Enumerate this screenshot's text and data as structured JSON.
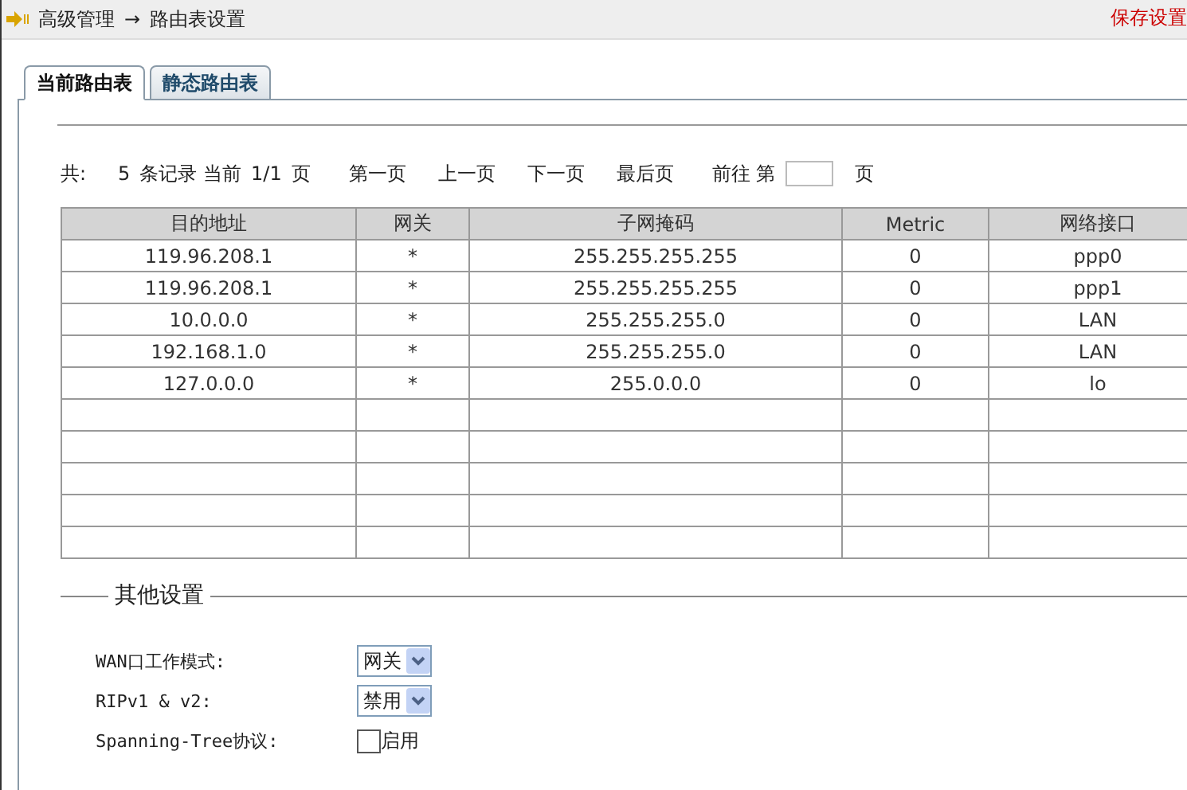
{
  "breadcrumb": {
    "parent": "高级管理",
    "separator": "→",
    "current": "路由表设置"
  },
  "save_link": "保存设置",
  "tabs": [
    {
      "label": "当前路由表",
      "selected": true
    },
    {
      "label": "静态路由表",
      "selected": false
    }
  ],
  "pagination": {
    "summary_prefix": "共:",
    "count": "5",
    "summary_mid": "条记录 当前",
    "page": "1/1",
    "page_unit": "页",
    "first": "第一页",
    "prev": "上一页",
    "next": "下一页",
    "last": "最后页",
    "goto_prefix": "前往 第",
    "goto_suffix": "页"
  },
  "table": {
    "columns": [
      "目的地址",
      "网关",
      "子网掩码",
      "Metric",
      "网络接口"
    ],
    "rows": [
      {
        "kind": "data",
        "cells": [
          "119.96.208.1",
          "*",
          "255.255.255.255",
          "0",
          "ppp0"
        ]
      },
      {
        "kind": "data",
        "cells": [
          "119.96.208.1",
          "*",
          "255.255.255.255",
          "0",
          "ppp1"
        ]
      },
      {
        "kind": "data",
        "cells": [
          "10.0.0.0",
          "*",
          "255.255.255.0",
          "0",
          "LAN"
        ]
      },
      {
        "kind": "data",
        "cells": [
          "192.168.1.0",
          "*",
          "255.255.255.0",
          "0",
          "LAN"
        ]
      },
      {
        "kind": "data",
        "cells": [
          "127.0.0.0",
          "*",
          "255.0.0.0",
          "0",
          "lo"
        ]
      },
      {
        "kind": "blank"
      },
      {
        "kind": "blank"
      },
      {
        "kind": "blank"
      },
      {
        "kind": "blank"
      },
      {
        "kind": "blank"
      }
    ]
  },
  "other_settings": {
    "legend": "其他设置",
    "items": [
      {
        "kind": "select",
        "label": "WAN口工作模式:",
        "value": "网关"
      },
      {
        "kind": "select",
        "label": "RIPv1 & v2:",
        "value": "禁用"
      },
      {
        "kind": "checkbox",
        "label": "Spanning-Tree协议:",
        "checked": false,
        "option": "启用"
      }
    ]
  }
}
